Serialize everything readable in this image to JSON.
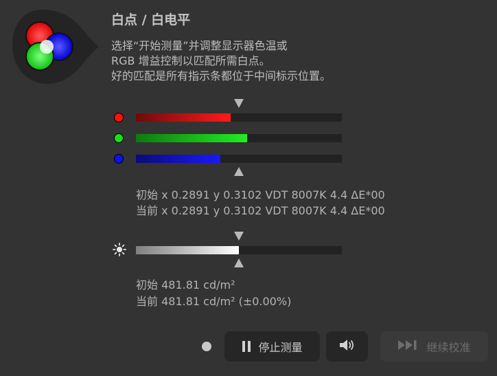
{
  "header": {
    "title": "白点 / 白电平",
    "instructions": [
      "选择“开始测量”并调整显示器色温或",
      "RGB 增益控制以匹配所需白点。",
      "好的匹配是所有指示条都位于中间标示位置。"
    ]
  },
  "channels": [
    {
      "name": "red",
      "color": "#ff1010",
      "fill_gradient": [
        "#6e0a0a",
        "#ff1a1a"
      ],
      "level_fraction": 0.46
    },
    {
      "name": "green",
      "color": "#17e017",
      "fill_gradient": [
        "#0d7a0d",
        "#22ee22"
      ],
      "level_fraction": 0.54
    },
    {
      "name": "blue",
      "color": "#1010ee",
      "fill_gradient": [
        "#0b0b7a",
        "#1818ff"
      ],
      "level_fraction": 0.41
    }
  ],
  "readouts": {
    "initial": "初始 x 0.2891 y 0.3102 VDT 8007K 4.4 ΔE*00",
    "current": "当前 x 0.2891 y 0.3102 VDT 8007K 4.4 ΔE*00"
  },
  "brightness": {
    "icon": "sun-icon",
    "level_fraction": 0.5,
    "initial": "初始 481.81 cd/m²",
    "current": "当前 481.81 cd/m² (±0.00%)"
  },
  "controls": {
    "stop_label": "停止测量",
    "continue_label": "继续校准",
    "pause_icon": "pause-icon",
    "sound_icon": "speaker-icon",
    "skip_icon": "skip-forward-icon",
    "status_icon": "status-dot-icon"
  },
  "colors": {
    "background": "#333333",
    "track": "#222222",
    "button": "#262626",
    "button_disabled": "#3a3a3a"
  }
}
